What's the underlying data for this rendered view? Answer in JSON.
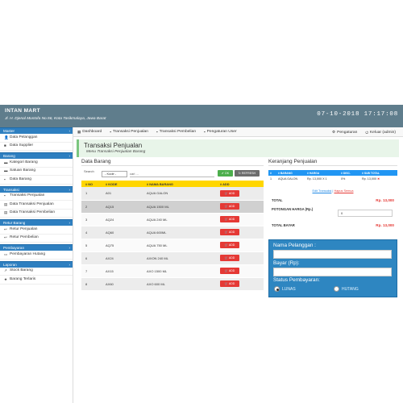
{
  "header": {
    "brand": "INTAN MART",
    "address": "Jl. H. Djenal Mustofa No.56, Kota Tasikmalaya, Jawa Barat",
    "datetime": "07-10-2018 17:17:08"
  },
  "sidebar": {
    "sections": [
      {
        "title": "Master",
        "items": [
          "Data Pelanggan",
          "Data Supplier"
        ]
      },
      {
        "title": "Barang",
        "items": [
          "Kategori Barang",
          "Satuan Barang",
          "Data Barang"
        ]
      },
      {
        "title": "Transaksi",
        "items": [
          "Transaksi Penjualan",
          "Data Transaksi Penjualan",
          "Data Transaksi Pembelian"
        ]
      },
      {
        "title": "Retur Barang",
        "items": [
          "Retur Penjualan",
          "Retur Pembelian"
        ]
      },
      {
        "title": "Pembayaran",
        "items": [
          "Pembayaran Hutang"
        ]
      },
      {
        "title": "Laporan",
        "items": [
          "Stock Barang",
          "Barang Terlaris"
        ]
      }
    ]
  },
  "navbar": {
    "items": [
      "Dashboard",
      "Transaksi Penjualan",
      "Transaksi Pembelian",
      "Pengaturan User"
    ],
    "settings": "Pengaturan",
    "logout": "Keluar (admin)"
  },
  "page": {
    "title": "Transaksi Penjualan",
    "subtitle": "Menu Transaksi Penjualan Barang"
  },
  "barang": {
    "title": "Data Barang",
    "search_label": "Search",
    "select_value": "- Kode -",
    "search_placeholder": "cari ...",
    "ok_label": "OK",
    "refresh_label": "REFRESH",
    "headers": [
      "NO",
      "KODE",
      "NAMA BARANG",
      "ADD"
    ],
    "add_label": "ADD",
    "rows": [
      {
        "no": "1",
        "kode": "A01",
        "nama": "AQUA GALON"
      },
      {
        "no": "2",
        "kode": "AQ15",
        "nama": "AQUA 1500 ML"
      },
      {
        "no": "3",
        "kode": "AQ24",
        "nama": "AQUA 240 ML"
      },
      {
        "no": "4",
        "kode": "AQ60",
        "nama": "AQUA 600ML"
      },
      {
        "no": "5",
        "kode": "AQ75",
        "nama": "AQUA 750 ML"
      },
      {
        "no": "6",
        "kode": "AX24",
        "nama": "AXION 240 ML"
      },
      {
        "no": "7",
        "kode": "AX15",
        "nama": "AXO 1500 ML"
      },
      {
        "no": "8",
        "kode": "AX60",
        "nama": "AXO 600 ML"
      }
    ]
  },
  "cart": {
    "title": "Keranjang Penjualan",
    "headers": [
      "#",
      "BARANG",
      "HARGA",
      "DISC.",
      "SUB TOTAL"
    ],
    "rows": [
      {
        "no": "1",
        "barang": "AQUA GALON",
        "harga": "Rp. 13,000 X 1",
        "disc": "0%",
        "subtotal": "Rp. 13,000"
      }
    ],
    "edit_link": "Edit Transaksi",
    "clear_link": "Hapus Semua",
    "total_label": "TOTAL",
    "total_value": "Rp. 13,000",
    "discount_label": "POTONGAN HARGA (Rp.)",
    "discount_value": "0",
    "grand_label": "TOTAL BAYAR",
    "grand_value": "Rp. 13,000"
  },
  "payment": {
    "customer_label": "Nama Pelanggan :",
    "pay_label": "Bayar (Rp):",
    "status_label": "Status Pembayaran:",
    "option_lunas": "LUNAS",
    "option_hutang": "HUTANG"
  }
}
